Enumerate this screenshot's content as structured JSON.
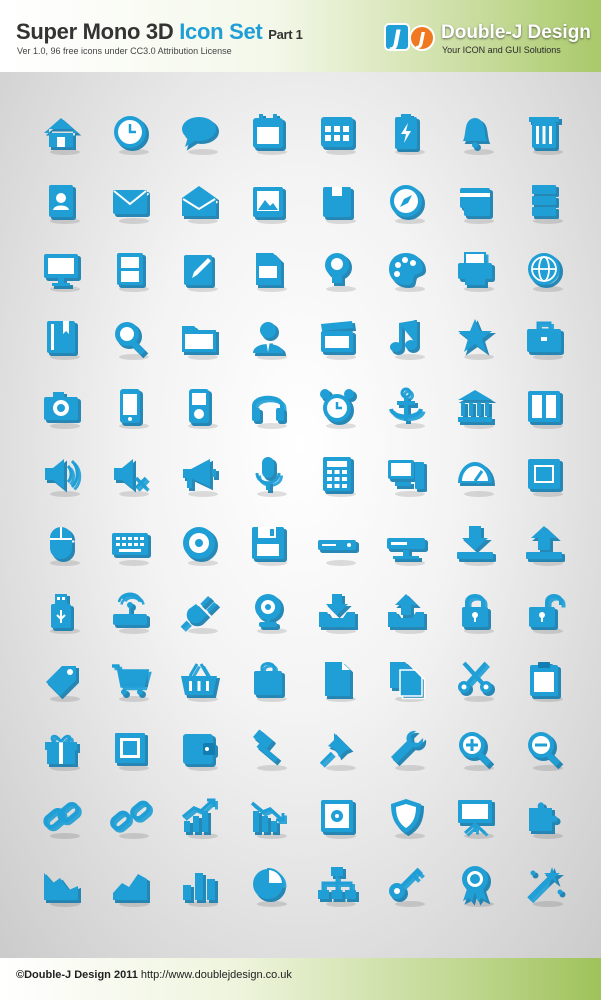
{
  "header": {
    "title_main": "Super Mono 3D",
    "title_accent": "Icon Set",
    "title_part": "Part 1",
    "subtitle": "Ver 1.0,  96 free icons under CC3.0 Attribution License",
    "brand_logo_text": "J",
    "brand_name": "Double-J Design",
    "brand_tagline": "Your ICON and GUI Solutions"
  },
  "colors": {
    "icon_blue": "#1f9fd6",
    "icon_dark": "#127db0",
    "accent_green": "#a9c96a"
  },
  "icons": [
    "home-icon",
    "clock-icon",
    "speech-bubble-icon",
    "calendar-icon",
    "calendar-grid-icon",
    "battery-icon",
    "bell-icon",
    "trash-icon",
    "address-book-icon",
    "mail-icon",
    "open-mail-icon",
    "photo-icon",
    "box-icon",
    "compass-icon",
    "credit-card-icon",
    "storage-icon",
    "monitor-icon",
    "drawer-icon",
    "edit-icon",
    "document-icon",
    "lightbulb-icon",
    "palette-icon",
    "printer-icon",
    "globe-icon",
    "book-icon",
    "search-icon",
    "folder-icon",
    "user-icon",
    "clapperboard-icon",
    "music-icon",
    "star-icon",
    "briefcase-icon",
    "camera-icon",
    "phone-icon",
    "ipod-icon",
    "headphones-icon",
    "alarm-clock-icon",
    "anchor-icon",
    "bank-icon",
    "open-book-icon",
    "speaker-icon",
    "mute-icon",
    "megaphone-icon",
    "microphone-icon",
    "calculator-icon",
    "computer-icon",
    "gauge-icon",
    "fullscreen-icon",
    "mouse-icon",
    "keyboard-icon",
    "cd-icon",
    "floppy-icon",
    "dvd-player-icon",
    "router-icon",
    "download-icon",
    "upload-icon",
    "usb-icon",
    "wireless-router-icon",
    "plug-icon",
    "webcam-icon",
    "inbox-download-icon",
    "inbox-upload-icon",
    "lock-icon",
    "unlock-icon",
    "tag-icon",
    "shopping-cart-icon",
    "basket-icon",
    "shopping-bag-icon",
    "file-icon",
    "copy-icon",
    "scissors-icon",
    "clipboard-icon",
    "gift-icon",
    "stamp-icon",
    "wallet-icon",
    "hammer-icon",
    "pin-icon",
    "wrench-icon",
    "zoom-in-icon",
    "zoom-out-icon",
    "link-icon",
    "unlink-icon",
    "growth-chart-icon",
    "decline-chart-icon",
    "safe-icon",
    "shield-icon",
    "presentation-icon",
    "puzzle-icon",
    "area-down-icon",
    "area-up-icon",
    "bar-chart-icon",
    "pie-chart-icon",
    "sitemap-icon",
    "key-icon",
    "award-icon",
    "magic-wand-icon"
  ],
  "footer": {
    "copyright": "©Double-J Design 2011",
    "url": "http://www.doublejdesign.co.uk"
  }
}
